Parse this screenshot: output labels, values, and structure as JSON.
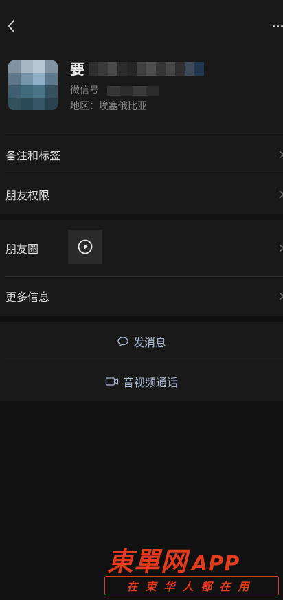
{
  "profile": {
    "nickname": "要",
    "wechat_id_label": "微信号",
    "region_label": "地区：",
    "region_value": "埃塞俄比亚"
  },
  "rows": {
    "remarks_tags": "备注和标签",
    "friend_permissions": "朋友权限",
    "moments": "朋友圈",
    "more_info": "更多信息"
  },
  "actions": {
    "send_message": "发消息",
    "video_call": "音视频通话"
  },
  "watermark": {
    "main": "東單网",
    "app": "APP",
    "slogan": "在東华人都在用"
  },
  "icons": {
    "back": "chevron-left-icon",
    "more": "more-dots-icon",
    "chevron": "chevron-right-icon",
    "play": "play-circle-icon",
    "message": "chat-bubble-icon",
    "video": "video-camera-icon"
  },
  "colors": {
    "background": "#111111",
    "panel": "#191919",
    "action_text": "#a9b8d5",
    "watermark": "#e23b1e"
  }
}
